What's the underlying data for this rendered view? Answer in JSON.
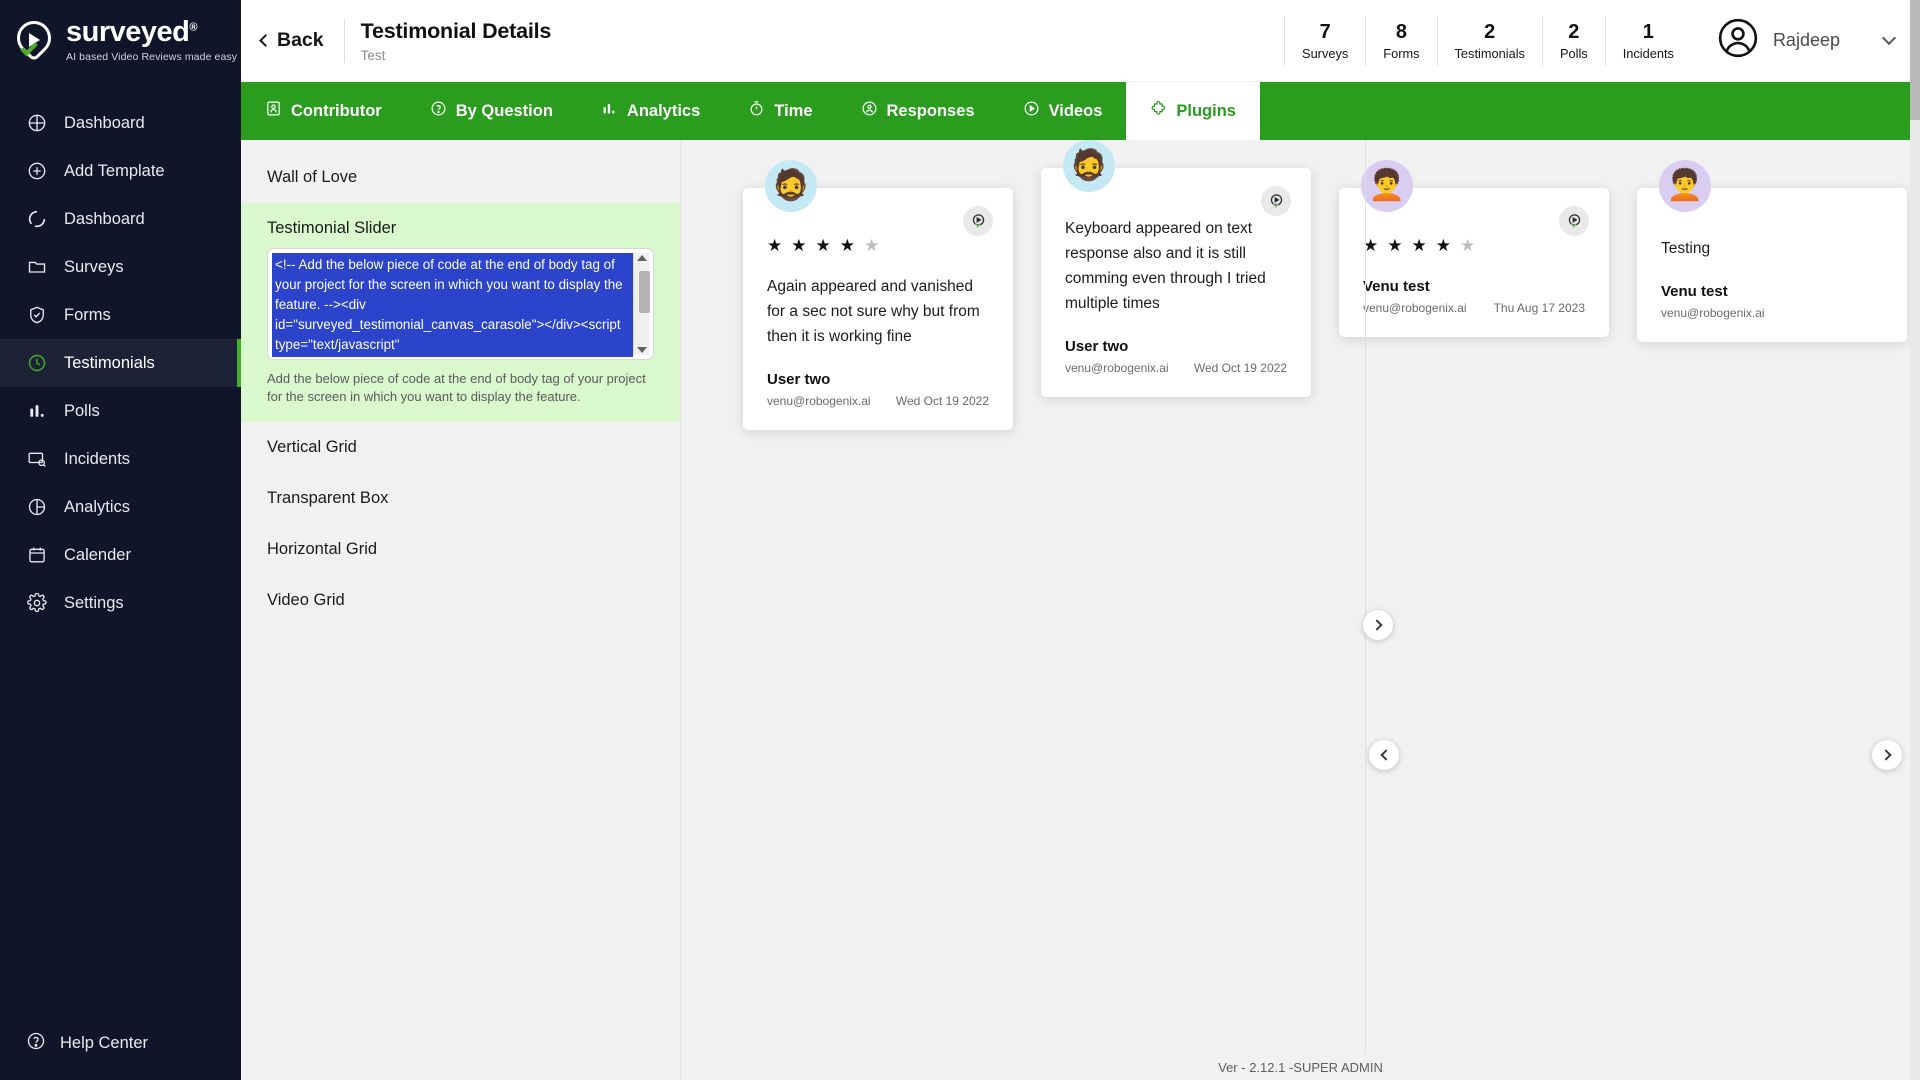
{
  "brand": {
    "name": "surveyed",
    "reg": "®",
    "tagline": "AI based Video Reviews made easy"
  },
  "sidebar": {
    "items": [
      {
        "label": "Dashboard",
        "icon": "dashboard-grid-icon",
        "active": false
      },
      {
        "label": "Add Template",
        "icon": "plus-circle-icon",
        "active": false
      },
      {
        "label": "Dashboard",
        "icon": "donut-icon",
        "active": false
      },
      {
        "label": "Surveys",
        "icon": "folder-icon",
        "active": false
      },
      {
        "label": "Forms",
        "icon": "shield-check-icon",
        "active": false
      },
      {
        "label": "Testimonials",
        "icon": "clock-icon",
        "active": true
      },
      {
        "label": "Polls",
        "icon": "bar-chart-icon",
        "active": false
      },
      {
        "label": "Incidents",
        "icon": "card-search-icon",
        "active": false
      },
      {
        "label": "Analytics",
        "icon": "pie-chart-icon",
        "active": false
      },
      {
        "label": "Calender",
        "icon": "calendar-icon",
        "active": false
      },
      {
        "label": "Settings",
        "icon": "gear-icon",
        "active": false
      }
    ],
    "help": {
      "label": "Help Center",
      "icon": "help-circle-icon"
    }
  },
  "header": {
    "back_label": "Back",
    "title": "Testimonial Details",
    "subtitle": "Test",
    "stats": [
      {
        "value": "7",
        "label": "Surveys"
      },
      {
        "value": "8",
        "label": "Forms"
      },
      {
        "value": "2",
        "label": "Testimonials"
      },
      {
        "value": "2",
        "label": "Polls"
      },
      {
        "value": "1",
        "label": "Incidents"
      }
    ],
    "user": {
      "name": "Rajdeep",
      "avatar_icon": "user-circle-icon",
      "caret_icon": "chevron-down-icon"
    }
  },
  "tabs": [
    {
      "label": "Contributor",
      "icon": "contributor-icon",
      "active": false
    },
    {
      "label": "By Question",
      "icon": "question-circle-icon",
      "active": false
    },
    {
      "label": "Analytics",
      "icon": "bar-chart-icon",
      "active": false
    },
    {
      "label": "Time",
      "icon": "stopwatch-icon",
      "active": false
    },
    {
      "label": "Responses",
      "icon": "responses-icon",
      "active": false
    },
    {
      "label": "Videos",
      "icon": "play-circle-icon",
      "active": false
    },
    {
      "label": "Plugins",
      "icon": "puzzle-icon",
      "active": true
    }
  ],
  "plugins": {
    "items": [
      {
        "label": "Wall of Love",
        "selected": false
      },
      {
        "label": "Testimonial Slider",
        "selected": true
      },
      {
        "label": "Vertical Grid",
        "selected": false
      },
      {
        "label": "Transparent Box",
        "selected": false
      },
      {
        "label": "Horizontal Grid",
        "selected": false
      },
      {
        "label": "Video Grid",
        "selected": false
      }
    ],
    "code_snippet": "<!-- Add the below piece of code at the end of body tag of your project for the screen in which you want to display the feature. --><div id=\"surveyed_testimonial_canvas_carasole\"></div><script type=\"text/javascript\"",
    "help_text": "Add the below piece of code at the end of body tag of your project for the screen in which you want to display the feature."
  },
  "testimonials": [
    {
      "avatar": "🧔",
      "avatar_tone": "blue",
      "rating_filled": 4,
      "rating_total": 5,
      "show_stars": true,
      "text": "Again appeared and vanished for a sec not sure why but from then it is working fine",
      "name": "User two",
      "email": "venu@robogenix.ai",
      "date": "Wed Oct 19 2022",
      "play_icon": "play-pin-icon"
    },
    {
      "avatar": "🧔",
      "avatar_tone": "blue",
      "rating_filled": 0,
      "rating_total": 5,
      "show_stars": false,
      "text": "Keyboard appeared on text response also and it is still comming even through I tried multiple times",
      "name": "User two",
      "email": "venu@robogenix.ai",
      "date": "Wed Oct 19 2022",
      "play_icon": "play-pin-icon"
    },
    {
      "avatar": "🧑‍🦱",
      "avatar_tone": "purple",
      "rating_filled": 4,
      "rating_total": 5,
      "show_stars": true,
      "text": "",
      "name": "Venu test",
      "email": "venu@robogenix.ai",
      "date": "Thu Aug 17 2023",
      "play_icon": "play-pin-icon"
    },
    {
      "avatar": "🧑‍🦱",
      "avatar_tone": "purple",
      "rating_filled": 0,
      "rating_total": 5,
      "show_stars": false,
      "text": "Testing",
      "name": "Venu test",
      "email": "venu@robogenix.ai",
      "date": "",
      "play_icon": "play-pin-icon"
    }
  ],
  "carousel": {
    "next_label": "›",
    "prev_label": "‹"
  },
  "footer": {
    "version": "Ver - 2.12.1 -SUPER ADMIN"
  },
  "colors": {
    "brand_green": "#2a9c1e",
    "sidebar_bg": "#11152a",
    "selection_blue": "#2b44cb",
    "plugin_selected_bg": "#d9f8cd"
  }
}
